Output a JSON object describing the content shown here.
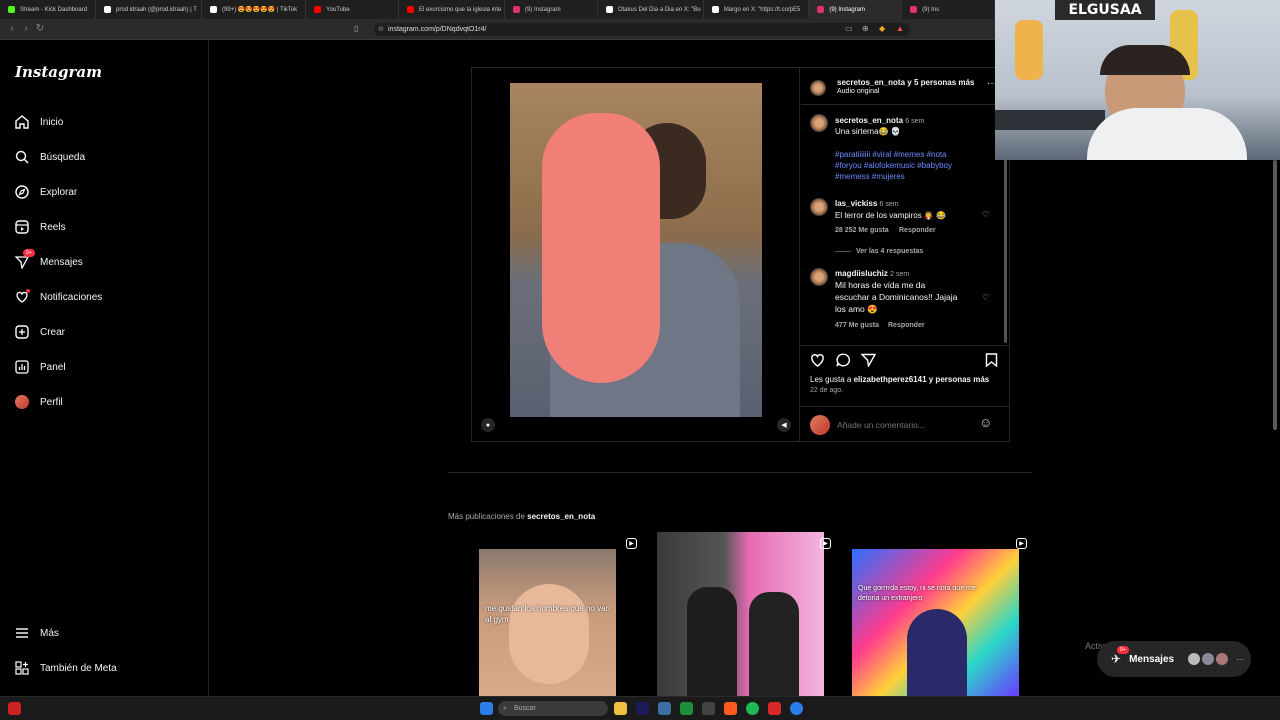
{
  "browser": {
    "tabs": [
      {
        "title": "Stream - Kick Dashboard",
        "color": "#53fc18"
      },
      {
        "title": "prod idraah (@prod.idraah) | T",
        "color": "#ffffff"
      },
      {
        "title": "(99+) 😍😍😍😍😍 | TikTok",
        "color": "#ffffff"
      },
      {
        "title": "YouTube",
        "color": "#ff0000"
      },
      {
        "title": "El exorcismo que la iglesia inte",
        "color": "#ff0000"
      },
      {
        "title": "(9) Instagram",
        "color": "#e1306c"
      },
      {
        "title": "Otakus Del Dia a Dia en X: \"Bu",
        "color": "#ffffff"
      },
      {
        "title": "Margo en X: \"https://t.co/pE5",
        "color": "#ffffff"
      },
      {
        "title": "(9) Instagram",
        "color": "#e1306c"
      },
      {
        "title": "(9) Ins",
        "color": "#e1306c"
      }
    ],
    "url": "instagram.com/p/DNqdvqtO1r4/"
  },
  "sidebar": {
    "logo": "Instagram",
    "items": [
      {
        "label": "Inicio",
        "icon": "home-icon"
      },
      {
        "label": "Búsqueda",
        "icon": "search-icon"
      },
      {
        "label": "Explorar",
        "icon": "compass-icon"
      },
      {
        "label": "Reels",
        "icon": "reels-icon"
      },
      {
        "label": "Mensajes",
        "icon": "messenger-icon",
        "badge": "9+"
      },
      {
        "label": "Notificaciones",
        "icon": "heart-icon"
      },
      {
        "label": "Crear",
        "icon": "plus-square-icon"
      },
      {
        "label": "Panel",
        "icon": "chart-icon"
      },
      {
        "label": "Perfil",
        "icon": "avatar"
      }
    ],
    "bottom": [
      {
        "label": "Más",
        "icon": "menu-icon"
      },
      {
        "label": "También de Meta",
        "icon": "meta-icon"
      }
    ]
  },
  "post": {
    "header_user": "secretos_en_nota",
    "header_more": "y 5 personas más",
    "audio": "Audio original",
    "author": "secretos_en_nota",
    "author_time": "6 sem",
    "caption": "Una sirterna😂 💀",
    "hashtags_line1": "#paratiiiiiii #viral #memes #nota",
    "hashtags_line2": "#foryou #alofokemusic #babyboy",
    "hashtags_line3": "#memess #mujeres",
    "comments": [
      {
        "user": "las_vickiss",
        "time": "6 sem",
        "text": "El terror de los vampiros 🧛 😂",
        "likes": "28 252 Me gusta",
        "reply": "Responder",
        "view_replies": "Ver las 4 respuestas"
      },
      {
        "user": "magdiisluchiz",
        "time": "2 sem",
        "text1": "Mil horas de vida me da",
        "text2": "escuchar a Dominicanos!! Jajaja",
        "text3": "los amo 😍",
        "likes": "477 Me gusta",
        "reply": "Responder"
      }
    ],
    "likes_prefix": "Les gusta a ",
    "likes_user": "elizabethperez6141",
    "likes_suffix": " y personas más",
    "date": "22 de ago.",
    "comment_placeholder": "Añade un comentario..."
  },
  "more": {
    "prefix": "Más publicaciones de ",
    "user": "secretos_en_nota",
    "thumbs": [
      {
        "caption": "me gustan los hombres que no van al gym"
      },
      {
        "caption": ""
      },
      {
        "caption": "Que gorrrrda estoy, ni se nota que me detona un extranjero"
      }
    ]
  },
  "overlay": {
    "activate": "Activar Windows",
    "messages_label": "Mensajes",
    "messages_badge": "9+"
  },
  "webcam": {
    "sign": "ELGUSAA"
  },
  "taskbar": {
    "search_placeholder": "Buscar"
  }
}
